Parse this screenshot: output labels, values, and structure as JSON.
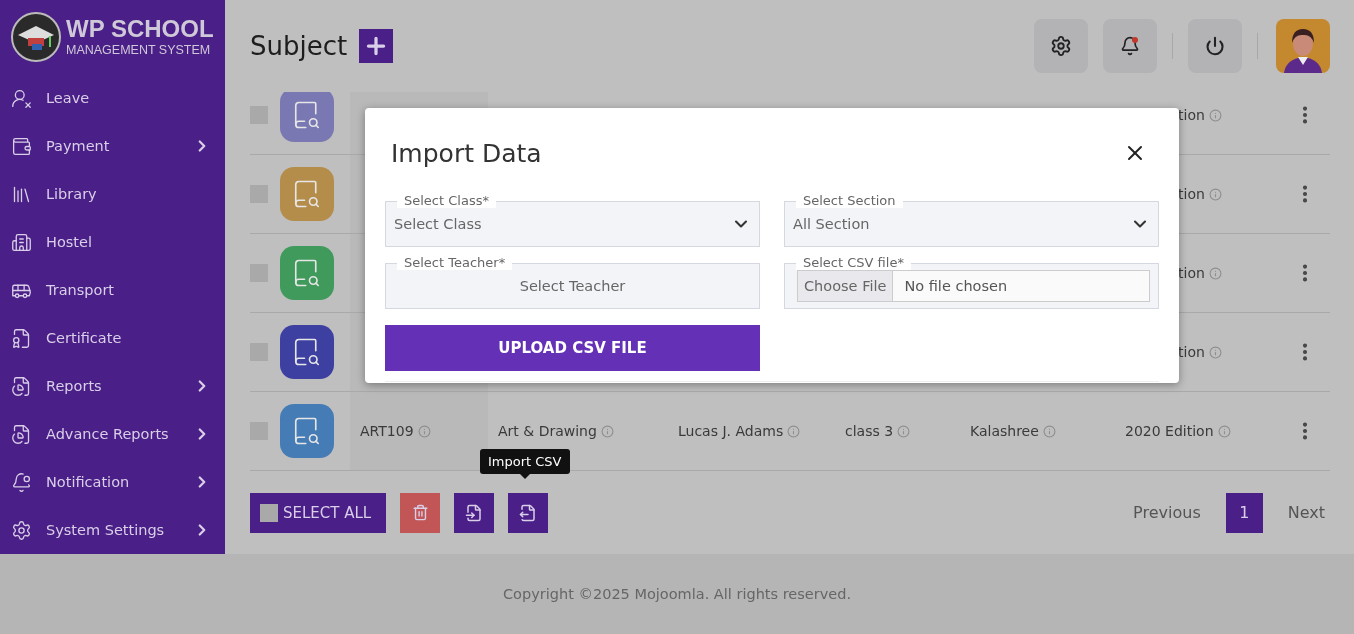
{
  "brand": {
    "title": "WP SCHOOL",
    "subtitle": "MANAGEMENT SYSTEM"
  },
  "sidebar": {
    "items": [
      {
        "label": "Leave",
        "kind": "leave",
        "expandable": false
      },
      {
        "label": "Payment",
        "kind": "payment",
        "expandable": true
      },
      {
        "label": "Library",
        "kind": "library",
        "expandable": false
      },
      {
        "label": "Hostel",
        "kind": "hostel",
        "expandable": false
      },
      {
        "label": "Transport",
        "kind": "transport",
        "expandable": false
      },
      {
        "label": "Certificate",
        "kind": "certificate",
        "expandable": false
      },
      {
        "label": "Reports",
        "kind": "reports",
        "expandable": true
      },
      {
        "label": "Advance Reports",
        "kind": "reports",
        "expandable": true
      },
      {
        "label": "Notification",
        "kind": "notification",
        "expandable": true
      },
      {
        "label": "System Settings",
        "kind": "settings",
        "expandable": true
      }
    ]
  },
  "header": {
    "title": "Subject",
    "notification_dot": true
  },
  "table": {
    "rows": [
      {
        "kind": "covered",
        "color": "#7a78b3",
        "checked": false,
        "edition": "tion"
      },
      {
        "kind": "covered",
        "color": "#b58d4a",
        "checked": false,
        "edition": "tion"
      },
      {
        "kind": "covered",
        "color": "#3f9a5b",
        "checked": false,
        "edition": "tion"
      },
      {
        "kind": "covered",
        "color": "#3d3fa1",
        "checked": false,
        "edition": "tion"
      },
      {
        "kind": "full",
        "color": "#457cb5",
        "checked": false,
        "code": "ART109",
        "subject": "Art & Drawing",
        "teacher": "Lucas J. Adams",
        "class": "class 3",
        "author": "Kalashree",
        "edition": "2020 Edition"
      }
    ]
  },
  "actions": {
    "select_all": {
      "label": "SELECT ALL",
      "checked": false
    },
    "tooltip": "Import CSV"
  },
  "pagination": {
    "previous": "Previous",
    "pages": [
      {
        "label": "1",
        "selected": true
      }
    ],
    "next": "Next"
  },
  "modal": {
    "title": "Import Data",
    "fields": [
      {
        "kind": "select",
        "label": "Select Class*",
        "value": "Select Class"
      },
      {
        "kind": "select",
        "label": "Select Section",
        "value": "All Section"
      },
      {
        "kind": "text",
        "label": "Select Teacher*",
        "value": "Select Teacher"
      },
      {
        "kind": "file",
        "label": "Select CSV file*",
        "button": "Choose File",
        "value": "No file chosen"
      }
    ],
    "submit": "UPLOAD CSV FILE"
  },
  "footer": "Copyright ©2025 Mojoomla. All rights reserved."
}
